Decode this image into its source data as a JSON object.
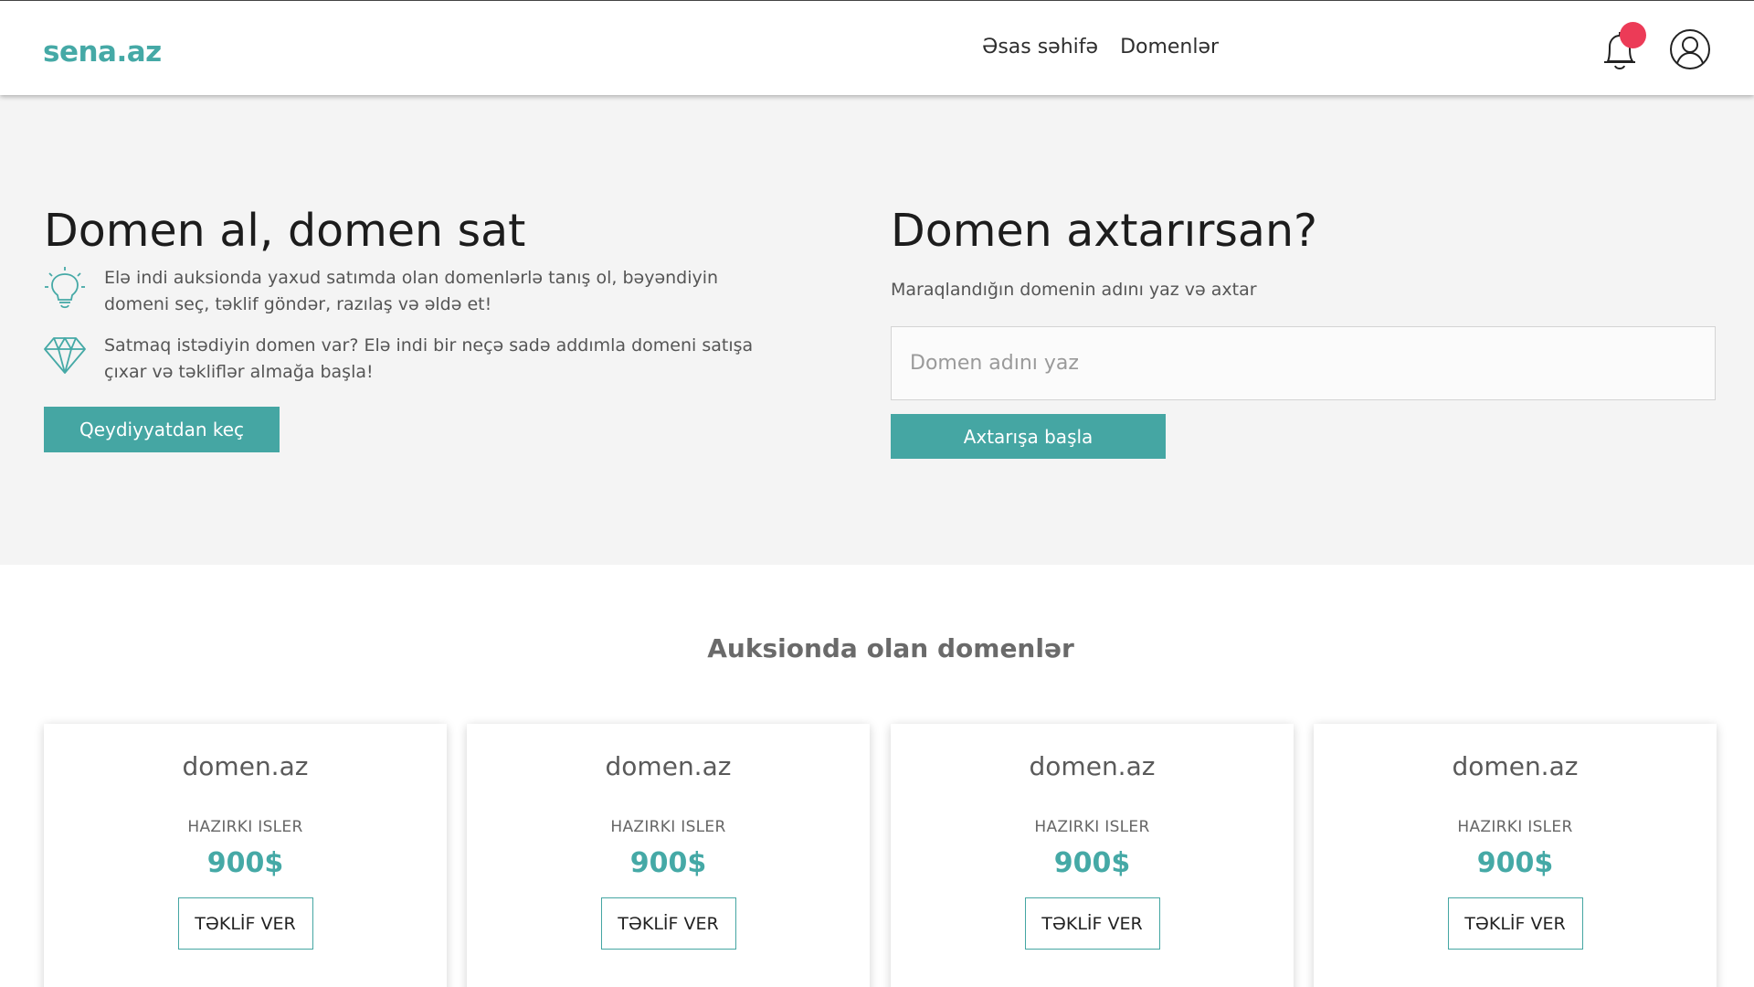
{
  "brand": {
    "logo": "sena.az",
    "accent_color": "#45a9a6",
    "badge_color": "#ec3b57"
  },
  "nav": {
    "items": [
      {
        "label": "Əsas səhifə"
      },
      {
        "label": "Domenlər"
      }
    ]
  },
  "header_icons": {
    "notifications": "bell-icon",
    "profile": "user-circle-icon"
  },
  "hero": {
    "title": "Domen al, domen sat",
    "features": [
      {
        "icon": "lightbulb-icon",
        "text": "Elə indi auksionda yaxud satımda olan domenlərlə tanış ol, bəyəndiyin domeni seç, təklif göndər, razılaş və əldə et!"
      },
      {
        "icon": "diamond-icon",
        "text": "Satmaq istədiyin domen var? Elə indi bir neçə sadə addımla domeni satışa çıxar və təkliflər almağa başla!"
      }
    ],
    "register_label": "Qeydiyyatdan keç"
  },
  "search": {
    "title": "Domen axtarırsan?",
    "subtitle": "Maraqlandığın domenin adını yaz və axtar",
    "placeholder": "Domen adını yaz",
    "button_label": "Axtarışa başla"
  },
  "auction": {
    "title": "Auksionda olan domenlər",
    "cards": [
      {
        "domain": "domen.az",
        "price_label": "HAZIRKI ISLER",
        "price": "900$",
        "offer_label": "TƏKLİF VER"
      },
      {
        "domain": "domen.az",
        "price_label": "HAZIRKI ISLER",
        "price": "900$",
        "offer_label": "TƏKLİF VER"
      },
      {
        "domain": "domen.az",
        "price_label": "HAZIRKI ISLER",
        "price": "900$",
        "offer_label": "TƏKLİF VER"
      },
      {
        "domain": "domen.az",
        "price_label": "HAZIRKI ISLER",
        "price": "900$",
        "offer_label": "TƏKLİF VER"
      }
    ]
  }
}
